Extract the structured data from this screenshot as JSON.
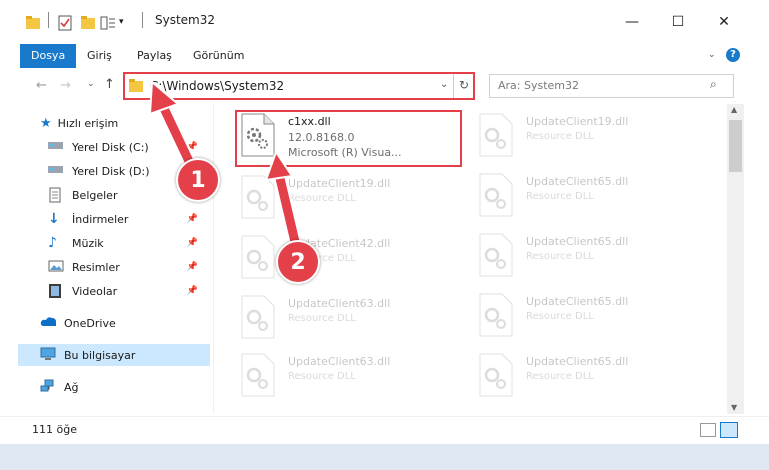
{
  "window": {
    "title": "System32"
  },
  "ribbon": {
    "tabs": [
      "Dosya",
      "Giriş",
      "Paylaş",
      "Görünüm"
    ]
  },
  "address": {
    "path": "C:\\Windows\\System32"
  },
  "search": {
    "placeholder": "Ara: System32"
  },
  "sidebar": {
    "items": [
      {
        "label": "Hızlı erişim",
        "icon": "star-icon"
      },
      {
        "label": "Yerel Disk (C:)",
        "icon": "drive-icon",
        "pinned": true
      },
      {
        "label": "Yerel Disk (D:)",
        "icon": "drive-icon"
      },
      {
        "label": "Belgeler",
        "icon": "document-icon"
      },
      {
        "label": "İndirmeler",
        "icon": "download-icon",
        "pinned": true
      },
      {
        "label": "Müzik",
        "icon": "music-icon",
        "pinned": true
      },
      {
        "label": "Resimler",
        "icon": "picture-icon",
        "pinned": true
      },
      {
        "label": "Videolar",
        "icon": "video-icon",
        "pinned": true
      },
      {
        "label": "OneDrive",
        "icon": "cloud-icon"
      },
      {
        "label": "Bu bilgisayar",
        "icon": "computer-icon",
        "selected": true
      },
      {
        "label": "Ağ",
        "icon": "network-icon"
      }
    ]
  },
  "files": {
    "selected": {
      "name": "c1xx.dll",
      "version": "12.0.8168.0",
      "company": "Microsoft (R) Visua..."
    },
    "left_faded": [
      {
        "name": "UpdateClient19.dll",
        "type": "Resource DLL"
      },
      {
        "name": "UpdateClient42.dll",
        "type": "Resource DLL"
      },
      {
        "name": "UpdateClient63.dll",
        "type": "Resource DLL"
      },
      {
        "name": "UpdateClient63.dll",
        "type": "Resource DLL"
      }
    ],
    "right_faded": [
      {
        "name": "UpdateClient19.dll",
        "type": "Resource DLL"
      },
      {
        "name": "UpdateClient65.dll",
        "type": "Resource DLL"
      },
      {
        "name": "UpdateClient65.dll",
        "type": "Resource DLL"
      },
      {
        "name": "UpdateClient65.dll",
        "type": "Resource DLL"
      },
      {
        "name": "UpdateClient65.dll",
        "type": "Resource DLL"
      }
    ]
  },
  "status": {
    "count": "111 öğe"
  },
  "annotations": {
    "step1": "1",
    "step2": "2",
    "accent": "#e3404a"
  },
  "colors": {
    "file_tab": "#1979ca",
    "selection": "#cce8ff"
  }
}
